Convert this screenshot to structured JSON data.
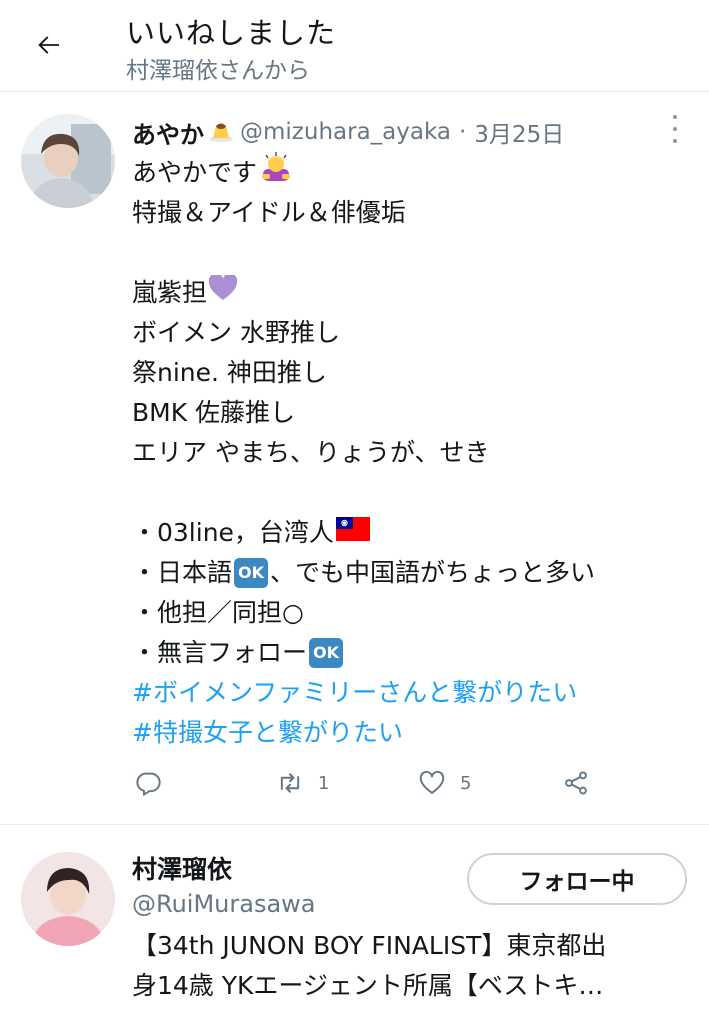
{
  "header": {
    "title": "いいねしました",
    "subtitle": "村澤瑠依さんから"
  },
  "tweet": {
    "name": "あやか",
    "name_emoji": "pudding-icon",
    "handle": "@mizuhara_ayaka",
    "separator": "·",
    "date": "3月25日",
    "lines": {
      "l1": "あやかです",
      "l2": "特撮＆アイドル＆俳優垢",
      "l3": "嵐紫担",
      "l4": "ボイメン 水野推し",
      "l5": "祭nine. 神田推し",
      "l6": "BMK 佐藤推し",
      "l7": "エリア やまち、りょうが、せき",
      "l8": "・03line，台湾人",
      "l9a": "・日本語",
      "l9b": "、でも中国語がちょっと多い",
      "l10": "・他担／同担○",
      "l11": "・無言フォロー"
    },
    "ok_label": "OK",
    "hashtags": [
      "#ボイメンファミリーさんと繋がりたい",
      "#特撮女子と繋がりたい"
    ],
    "retweet_count": "1",
    "like_count": "5"
  },
  "user": {
    "name": "村澤瑠依",
    "handle": "@RuiMurasawa",
    "follow_label": "フォロー中",
    "bio_lines": [
      "【34th JUNON BOY FINALIST】東京都出",
      "身14歳 YKエージェント所属【ベストキ…"
    ]
  },
  "colors": {
    "text": "#14171a",
    "secondary": "#657786",
    "accent": "#1da1f2",
    "divider": "#e6ecf0",
    "ok_badge": "#3b88c3",
    "heart_purple": "#aa8ed6"
  }
}
